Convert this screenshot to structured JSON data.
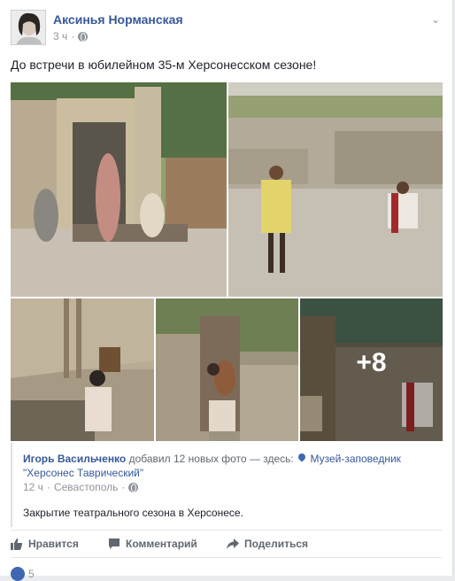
{
  "post": {
    "author": "Аксинья Норманская",
    "time": "3 ч",
    "text": "До встречи в юбилейном 35-м Херсонесском сезоне!"
  },
  "photos": {
    "more_count": "+8"
  },
  "shared": {
    "author": "Игорь Васильченко",
    "added_text": "добавил 12 новых фото — здесь:",
    "place": "Музей-заповедник \"Херсонес Таврический\"",
    "time": "12 ч",
    "location": "Севастополь",
    "text": "Закрытие театрального сезона в Херсонесе."
  },
  "actions": {
    "like": "Нравится",
    "comment": "Комментарий",
    "share": "Поделиться"
  },
  "reactions": {
    "count": "5"
  },
  "icons": {
    "globe": "globe-icon",
    "chevron": "chevron-down-icon",
    "pin": "map-pin-icon",
    "like": "thumbs-up-icon",
    "comment": "comment-icon",
    "share": "share-icon"
  },
  "colors": {
    "link": "#365899",
    "muted": "#90949c",
    "action": "#616770",
    "like_badge": "#4267b2"
  }
}
